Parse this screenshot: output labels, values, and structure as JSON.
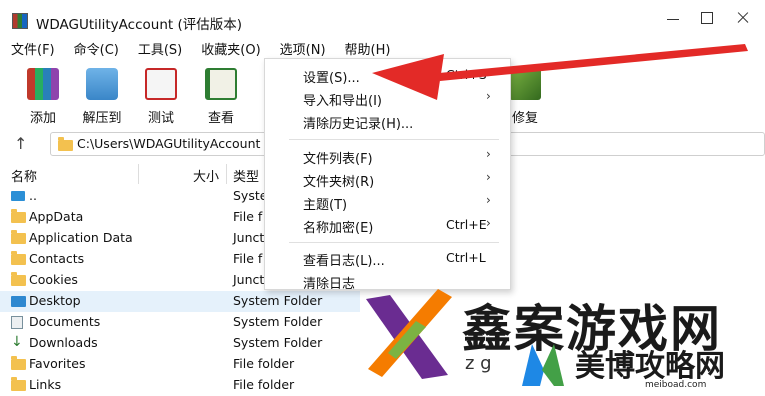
{
  "window": {
    "title": "WDAGUtilityAccount (评估版本)"
  },
  "menubar": [
    "文件(F)",
    "命令(C)",
    "工具(S)",
    "收藏夹(O)",
    "选项(N)",
    "帮助(H)"
  ],
  "toolbar": {
    "add": "添加",
    "extract": "解压到",
    "test": "测试",
    "view": "查看",
    "repair": "修复"
  },
  "address": {
    "path": "C:\\Users\\WDAGUtilityAccount"
  },
  "columns": {
    "name": "名称",
    "size": "大小",
    "type": "类型"
  },
  "files": [
    {
      "name": "..",
      "type": "Syste",
      "icon": "drive-icon"
    },
    {
      "name": "AppData",
      "type": "File f",
      "icon": "folder-icon"
    },
    {
      "name": "Application Data",
      "type": "Junct",
      "icon": "folder-icon"
    },
    {
      "name": "Contacts",
      "type": "File f",
      "icon": "folder-icon"
    },
    {
      "name": "Cookies",
      "type": "Junct",
      "icon": "folder-icon"
    },
    {
      "name": "Desktop",
      "type": "System Folder",
      "icon": "desktop-icon"
    },
    {
      "name": "Documents",
      "type": "System Folder",
      "icon": "documents-icon"
    },
    {
      "name": "Downloads",
      "type": "System Folder",
      "icon": "download-icon"
    },
    {
      "name": "Favorites",
      "type": "File folder",
      "icon": "folder-icon"
    },
    {
      "name": "Links",
      "type": "File folder",
      "icon": "folder-icon"
    }
  ],
  "options_menu": {
    "settings": "设置(S)...",
    "settings_shortcut": "Ctrl+S",
    "import_export": "导入和导出(I)",
    "clear_history": "清除历史记录(H)...",
    "file_list": "文件列表(F)",
    "folder_tree": "文件夹树(R)",
    "theme": "主题(T)",
    "name_encryption": "名称加密(E)",
    "name_encryption_shortcut": "Ctrl+E",
    "view_log": "查看日志(L)...",
    "view_log_shortcut": "Ctrl+L",
    "clear_log": "清除日志"
  },
  "watermark": {
    "brand1": "鑫案游戏网",
    "brand1_sub": "z  g",
    "brand2": "美博攻略网",
    "brand2_url": "meiboad.com"
  },
  "colors": {
    "accent_red": "#e32a27",
    "selection": "#e5f1fb",
    "folder": "#f3c14f"
  }
}
